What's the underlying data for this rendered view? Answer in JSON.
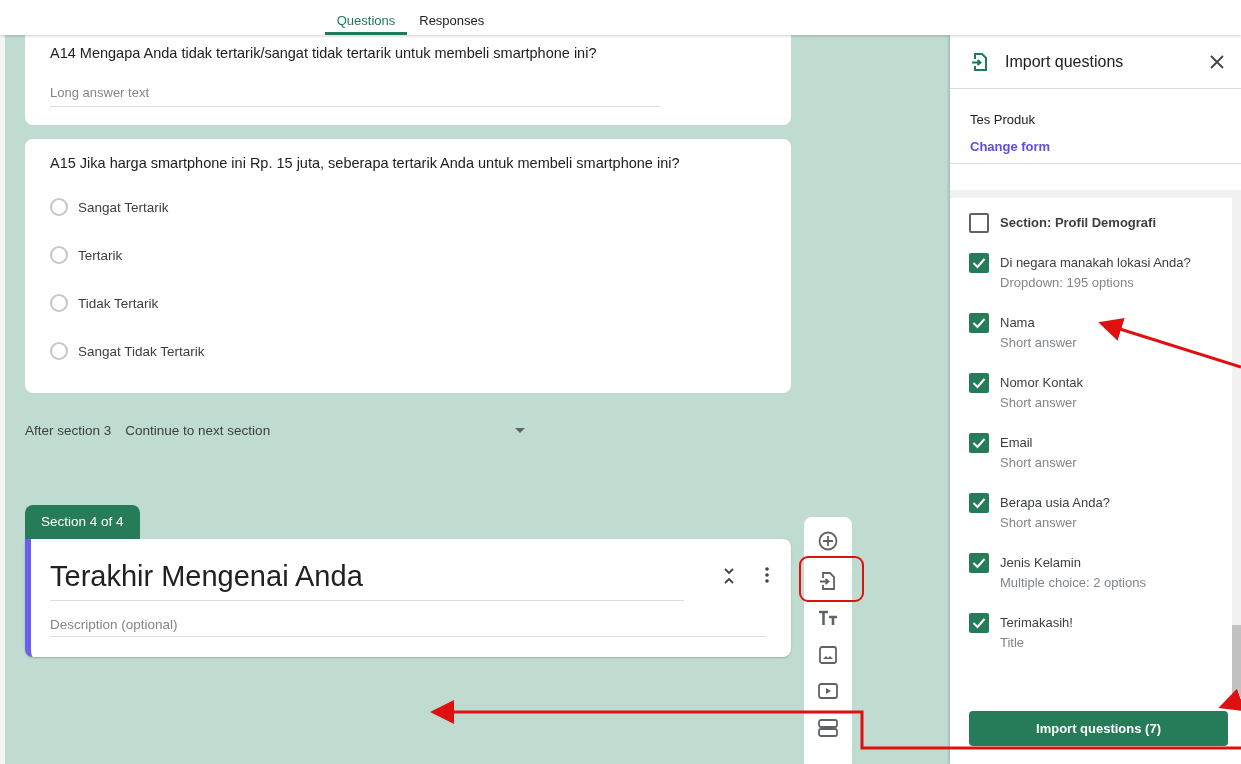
{
  "tabs": [
    {
      "label": "Questions",
      "selected": true
    },
    {
      "label": "Responses",
      "selected": false
    }
  ],
  "questions": [
    {
      "kind": "paragraph",
      "title": "A14 Mengapa Anda tidak tertarik/sangat tidak tertarik untuk membeli smartphone ini?",
      "placeholder": "Long answer text"
    },
    {
      "kind": "choice",
      "title": "A15 Jika harga smartphone ini Rp. 15 juta, seberapa tertarik Anda untuk membeli smartphone ini?",
      "options": [
        {
          "label": "Sangat Tertarik",
          "selected": false
        },
        {
          "label": "Tertarik",
          "selected": false
        },
        {
          "label": "Tidak Tertarik",
          "selected": false
        },
        {
          "label": "Sangat Tidak Tertarik",
          "selected": false
        }
      ]
    }
  ],
  "after_section": {
    "label": "After section 3",
    "value": "Continue to next section"
  },
  "section": {
    "badge": "Section 4 of 4",
    "title": "Terakhir Mengenai Anda",
    "description_placeholder": "Description (optional)"
  },
  "import_panel": {
    "title": "Import questions",
    "form_name": "Tes Produk",
    "change_link": "Change form",
    "items": [
      {
        "kind": "section",
        "label": "Section: Profil Demografi",
        "checked": false
      },
      {
        "kind": "question",
        "label": "Di negara manakah lokasi Anda?",
        "detail": "Dropdown: 195 options",
        "checked": true
      },
      {
        "kind": "question",
        "label": "Nama",
        "detail": "Short answer",
        "checked": true
      },
      {
        "kind": "question",
        "label": "Nomor Kontak",
        "detail": "Short answer",
        "checked": true
      },
      {
        "kind": "question",
        "label": "Email",
        "detail": "Short answer",
        "checked": true
      },
      {
        "kind": "question",
        "label": "Berapa usia Anda?",
        "detail": "Short answer",
        "checked": true
      },
      {
        "kind": "question",
        "label": "Jenis Kelamin",
        "detail": "Multiple choice: 2 options",
        "checked": true
      },
      {
        "kind": "question",
        "label": "Terimakasih!",
        "detail": "Title",
        "checked": true
      }
    ],
    "button": "Import questions (7)"
  }
}
